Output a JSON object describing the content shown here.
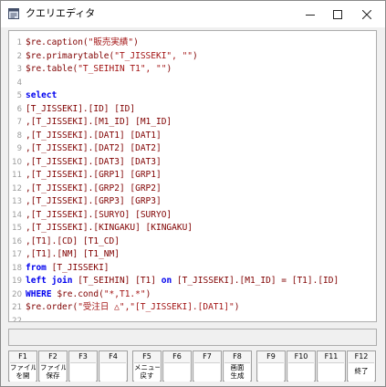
{
  "window": {
    "title": "クエリエディタ"
  },
  "colors": {
    "keyword": "#0000ee",
    "default": "#800000",
    "string": "#a31515",
    "plain": "#000000",
    "line_number": "#9a9a9a"
  },
  "editor": {
    "lines": [
      {
        "n": "1",
        "tokens": [
          {
            "t": "$re.caption(",
            "c": "default"
          },
          {
            "t": "\"販売実績\"",
            "c": "string"
          },
          {
            "t": ")",
            "c": "default"
          }
        ]
      },
      {
        "n": "2",
        "tokens": [
          {
            "t": "$re.primarytable(",
            "c": "default"
          },
          {
            "t": "\"T_JISSEKI\", \"\"",
            "c": "string"
          },
          {
            "t": ")",
            "c": "default"
          }
        ]
      },
      {
        "n": "3",
        "tokens": [
          {
            "t": "$re.table(",
            "c": "default"
          },
          {
            "t": "\"T_SEIHIN T1\", \"\"",
            "c": "string"
          },
          {
            "t": ")",
            "c": "default"
          }
        ]
      },
      {
        "n": "4",
        "tokens": []
      },
      {
        "n": "5",
        "tokens": [
          {
            "t": "select",
            "c": "keyword"
          }
        ]
      },
      {
        "n": "6",
        "tokens": [
          {
            "t": "[T_JISSEKI].[ID] [ID]",
            "c": "default"
          }
        ]
      },
      {
        "n": "7",
        "tokens": [
          {
            "t": ",[T_JISSEKI].[M1_ID] [M1_ID]",
            "c": "default"
          }
        ]
      },
      {
        "n": "8",
        "tokens": [
          {
            "t": ",[T_JISSEKI].[DAT1] [DAT1]",
            "c": "default"
          }
        ]
      },
      {
        "n": "9",
        "tokens": [
          {
            "t": ",[T_JISSEKI].[DAT2] [DAT2]",
            "c": "default"
          }
        ]
      },
      {
        "n": "10",
        "tokens": [
          {
            "t": ",[T_JISSEKI].[DAT3] [DAT3]",
            "c": "default"
          }
        ]
      },
      {
        "n": "11",
        "tokens": [
          {
            "t": ",[T_JISSEKI].[GRP1] [GRP1]",
            "c": "default"
          }
        ]
      },
      {
        "n": "12",
        "tokens": [
          {
            "t": ",[T_JISSEKI].[GRP2] [GRP2]",
            "c": "default"
          }
        ]
      },
      {
        "n": "13",
        "tokens": [
          {
            "t": ",[T_JISSEKI].[GRP3] [GRP3]",
            "c": "default"
          }
        ]
      },
      {
        "n": "14",
        "tokens": [
          {
            "t": ",[T_JISSEKI].[SURYO] [SURYO]",
            "c": "default"
          }
        ]
      },
      {
        "n": "15",
        "tokens": [
          {
            "t": ",[T_JISSEKI].[KINGAKU] [KINGAKU]",
            "c": "default"
          }
        ]
      },
      {
        "n": "16",
        "tokens": [
          {
            "t": ",[T1].[CD] [T1_CD]",
            "c": "default"
          }
        ]
      },
      {
        "n": "17",
        "tokens": [
          {
            "t": ",[T1].[NM] [T1_NM]",
            "c": "default"
          }
        ]
      },
      {
        "n": "18",
        "tokens": [
          {
            "t": "from ",
            "c": "keyword"
          },
          {
            "t": "[T_JISSEKI]",
            "c": "default"
          }
        ]
      },
      {
        "n": "19",
        "tokens": [
          {
            "t": "left join ",
            "c": "keyword"
          },
          {
            "t": "[T_SEIHIN] [T1] ",
            "c": "default"
          },
          {
            "t": "on ",
            "c": "keyword"
          },
          {
            "t": "[T_JISSEKI].[M1_ID] = [T1].[ID]",
            "c": "default"
          }
        ]
      },
      {
        "n": "20",
        "tokens": [
          {
            "t": "WHERE ",
            "c": "keyword"
          },
          {
            "t": "$re.cond(",
            "c": "default"
          },
          {
            "t": "\"*,T1.*\"",
            "c": "string"
          },
          {
            "t": ")",
            "c": "default"
          }
        ]
      },
      {
        "n": "21",
        "tokens": [
          {
            "t": "$re.order(",
            "c": "default"
          },
          {
            "t": "\"受注日 △\",\"[T_JISSEKI].[DAT1]\"",
            "c": "string"
          },
          {
            "t": ")",
            "c": "default"
          }
        ]
      },
      {
        "n": "22",
        "tokens": []
      }
    ]
  },
  "status": {
    "text": ""
  },
  "fkeys": [
    {
      "key": "F1",
      "label": "ファイル\nを開",
      "name": "f1-open-file-button"
    },
    {
      "key": "F2",
      "label": "ファイル\n保存",
      "name": "f2-save-file-button"
    },
    {
      "key": "F3",
      "label": "",
      "name": "f3-button"
    },
    {
      "key": "F4",
      "label": "",
      "name": "f4-button"
    },
    {
      "key": "F5",
      "label": "メニュー\n戻す",
      "name": "f5-back-button"
    },
    {
      "key": "F6",
      "label": "",
      "name": "f6-button"
    },
    {
      "key": "F7",
      "label": "",
      "name": "f7-button"
    },
    {
      "key": "F8",
      "label": "画面\n生成",
      "name": "f8-generate-screen-button"
    },
    {
      "key": "F9",
      "label": "",
      "name": "f9-button"
    },
    {
      "key": "F10",
      "label": "",
      "name": "f10-button"
    },
    {
      "key": "F11",
      "label": "",
      "name": "f11-button"
    },
    {
      "key": "F12",
      "label": "終了",
      "name": "f12-exit-button"
    }
  ]
}
